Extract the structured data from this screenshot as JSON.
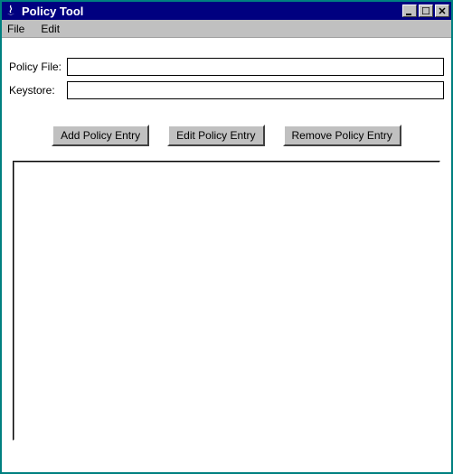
{
  "title": "Policy Tool",
  "menu": {
    "file": "File",
    "edit": "Edit"
  },
  "form": {
    "policy_file_label": "Policy File:",
    "policy_file_value": "",
    "keystore_label": "Keystore:",
    "keystore_value": ""
  },
  "buttons": {
    "add": "Add Policy Entry",
    "edit": "Edit Policy Entry",
    "remove": "Remove Policy Entry"
  }
}
